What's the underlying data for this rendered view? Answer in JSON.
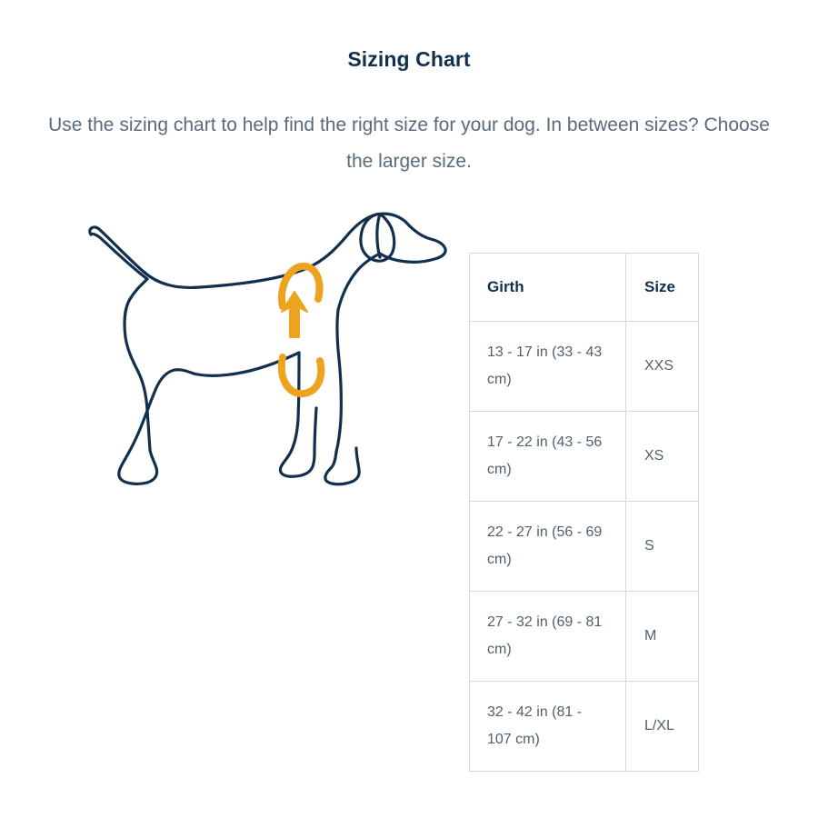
{
  "header": {
    "title": "Sizing Chart",
    "subtitle": "Use the sizing chart to help find the right size for your dog. In between sizes? Choose the larger size."
  },
  "illustration": {
    "name": "dog-side-view-girth-diagram",
    "outline_color": "#12304e",
    "measure_color": "#eda31e",
    "measurement_label": "girth"
  },
  "table": {
    "columns": [
      "Girth",
      "Size"
    ],
    "rows": [
      {
        "girth": "13 - 17 in (33 - 43 cm)",
        "size": "XXS"
      },
      {
        "girth": "17 - 22 in (43 - 56 cm)",
        "size": "XS"
      },
      {
        "girth": "22 - 27 in (56 - 69 cm)",
        "size": "S"
      },
      {
        "girth": "27 - 32 in (69 - 81 cm)",
        "size": "M"
      },
      {
        "girth": "32 - 42 in (81 - 107 cm)",
        "size": "L/XL"
      }
    ],
    "border_color": "#d5d8dc",
    "header_color": "#12304e",
    "cell_color": "#51616f"
  }
}
